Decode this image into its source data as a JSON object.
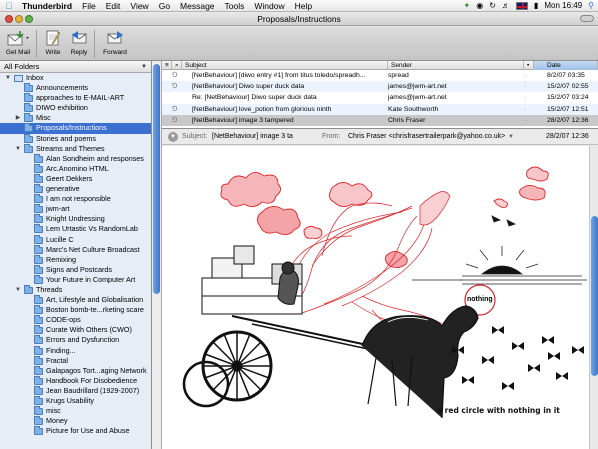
{
  "menubar": {
    "app": "Thunderbird",
    "items": [
      "File",
      "Edit",
      "View",
      "Go",
      "Message",
      "Tools",
      "Window",
      "Help"
    ],
    "clock": "Mon 16:49"
  },
  "window": {
    "title": "Proposals/Instructions"
  },
  "toolbar": {
    "get_mail": "Get Mail",
    "write": "Write",
    "reply": "Reply",
    "forward": "Forward"
  },
  "folders": {
    "header": "All Folders",
    "items": [
      {
        "label": "Inbox",
        "level": 0,
        "twisty": "open",
        "icon": "inbox"
      },
      {
        "label": "Announcements",
        "level": 1
      },
      {
        "label": "approaches to E-MAIL-ART",
        "level": 1
      },
      {
        "label": "DIWO exhibition",
        "level": 1
      },
      {
        "label": "Misc",
        "level": 1,
        "twisty": "closed"
      },
      {
        "label": "Proposals/Instructions",
        "level": 1,
        "selected": true
      },
      {
        "label": "Stories and poems",
        "level": 1
      },
      {
        "label": "Streams and Themes",
        "level": 1,
        "twisty": "open"
      },
      {
        "label": "Alan Sondheim and responses",
        "level": 2
      },
      {
        "label": "Arc.Anomino HTML",
        "level": 2
      },
      {
        "label": "Geert Dekkers",
        "level": 2
      },
      {
        "label": "generative",
        "level": 2
      },
      {
        "label": "I am not responsible",
        "level": 2
      },
      {
        "label": "jwm-art",
        "level": 2
      },
      {
        "label": "Knight Undressing",
        "level": 2
      },
      {
        "label": "Lem Urtastic Vs RandomLab",
        "level": 2
      },
      {
        "label": "Lucille C",
        "level": 2
      },
      {
        "label": "Marc's Net Culture Broadcast",
        "level": 2
      },
      {
        "label": "Remixing",
        "level": 2
      },
      {
        "label": "Signs and Postcards",
        "level": 2
      },
      {
        "label": "Your Future in Computer Art",
        "level": 2
      },
      {
        "label": "Threads",
        "level": 1,
        "twisty": "open"
      },
      {
        "label": "Art, Lifestyle and Globalisation",
        "level": 2
      },
      {
        "label": "Boston bomb-te...rketing scare",
        "level": 2
      },
      {
        "label": "CODE-ops",
        "level": 2
      },
      {
        "label": "Curate With Others (CWO)",
        "level": 2
      },
      {
        "label": "Errors and Dysfunction",
        "level": 2
      },
      {
        "label": "Finding...",
        "level": 2
      },
      {
        "label": "Fractal",
        "level": 2
      },
      {
        "label": "Galapagos Tort...aging Network",
        "level": 2
      },
      {
        "label": "Handbook For Disobedience",
        "level": 2
      },
      {
        "label": "Jean Baudrillard (1929-2007)",
        "level": 2
      },
      {
        "label": "Krugs Usability",
        "level": 2
      },
      {
        "label": "misc",
        "level": 2
      },
      {
        "label": "Money",
        "level": 2
      },
      {
        "label": "Picture for Use and Abuse",
        "level": 2
      }
    ]
  },
  "message_list": {
    "columns": {
      "subject": "Subject",
      "sender": "Sender",
      "date": "Date"
    },
    "rows": [
      {
        "subject": "[NetBehaviour] [diwo entry #1] from titus toledo/spreadh...",
        "sender": "spread",
        "date": "8/2/07 03:35",
        "attachment": true
      },
      {
        "subject": "[NetBehaviour] Diwo super duck data",
        "sender": "james@jwm-art.net",
        "date": "15/2/07 02:55",
        "attachment": true
      },
      {
        "subject": "Re: [NetBehaviour] Diwo super duck data",
        "sender": "james@jwm-art.net",
        "date": "15/2/07 03:24",
        "attachment": false
      },
      {
        "subject": "[NetBehaviour] love_potion from glorious ninth",
        "sender": "Kate Southworth",
        "date": "15/2/07 12:51",
        "attachment": true
      },
      {
        "subject": "[NetBehaviour] image 3 tampered",
        "sender": "Chris Fraser",
        "date": "28/2/07 12:36",
        "attachment": true,
        "selected": true
      }
    ]
  },
  "header": {
    "subject_label": "Subject:",
    "subject": "[NetBehaviour] image 3 ta",
    "from_label": "From:",
    "from": "Chris Fraser <chrisfrasertrailerpark@yahoo.co.uk>",
    "date": "28/2/07 12:36"
  },
  "preview": {
    "label_nothing": "nothing",
    "caption": "a red circle with nothing in it"
  },
  "colors": {
    "selection": "#3b6fd0",
    "sketch_red": "#d9252b"
  }
}
